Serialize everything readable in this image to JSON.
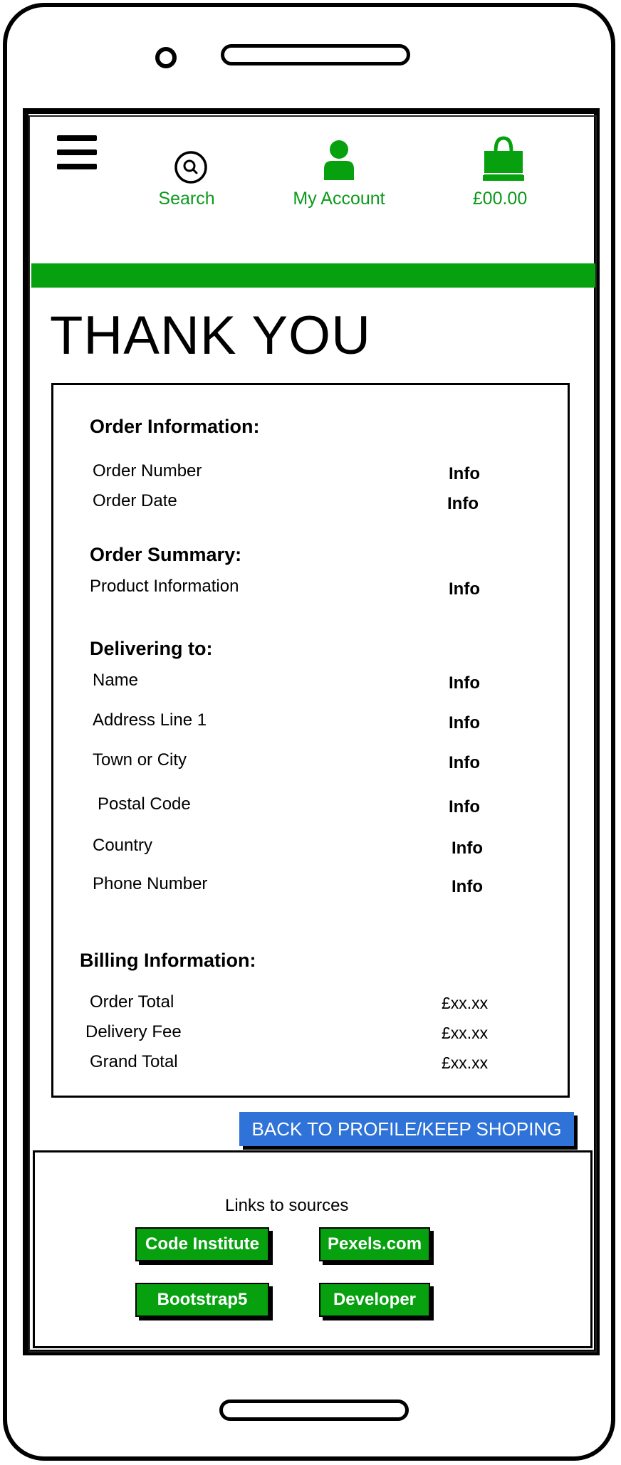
{
  "header": {
    "nav": [
      {
        "label": "Search",
        "icon": "search-icon"
      },
      {
        "label": "My Account",
        "icon": "user-icon"
      },
      {
        "label": "£00.00",
        "icon": "shopping-bag-icon"
      }
    ],
    "menu_icon": "hamburger-menu-icon",
    "accent_color": "#07a10f"
  },
  "page": {
    "title": "THANK YOU"
  },
  "order_information": {
    "heading": "Order Information:",
    "rows": [
      {
        "label": "Order Number",
        "value": "Info"
      },
      {
        "label": "Order Date",
        "value": "Info"
      }
    ]
  },
  "order_summary": {
    "heading": "Order Summary:",
    "rows": [
      {
        "label": "Product Information",
        "value": "Info"
      }
    ]
  },
  "delivering_to": {
    "heading": "Delivering to:",
    "rows": [
      {
        "label": "Name",
        "value": "Info"
      },
      {
        "label": "Address Line 1",
        "value": "Info"
      },
      {
        "label": "Town or City",
        "value": "Info"
      },
      {
        "label": "Postal Code",
        "value": "Info"
      },
      {
        "label": "Country",
        "value": "Info"
      },
      {
        "label": "Phone Number",
        "value": "Info"
      }
    ]
  },
  "billing_information": {
    "heading": "Billing Information:",
    "rows": [
      {
        "label": "Order Total",
        "value": "£xx.xx"
      },
      {
        "label": "Delivery Fee",
        "value": "£xx.xx"
      },
      {
        "label": "Grand Total",
        "value": "£xx.xx"
      }
    ]
  },
  "cta": {
    "label": "BACK TO PROFILE/KEEP SHOPING",
    "color": "#2f73d8"
  },
  "footer": {
    "title": "Links to sources",
    "links": [
      "Code Institute",
      "Pexels.com",
      "Bootstrap5",
      "Developer"
    ]
  }
}
